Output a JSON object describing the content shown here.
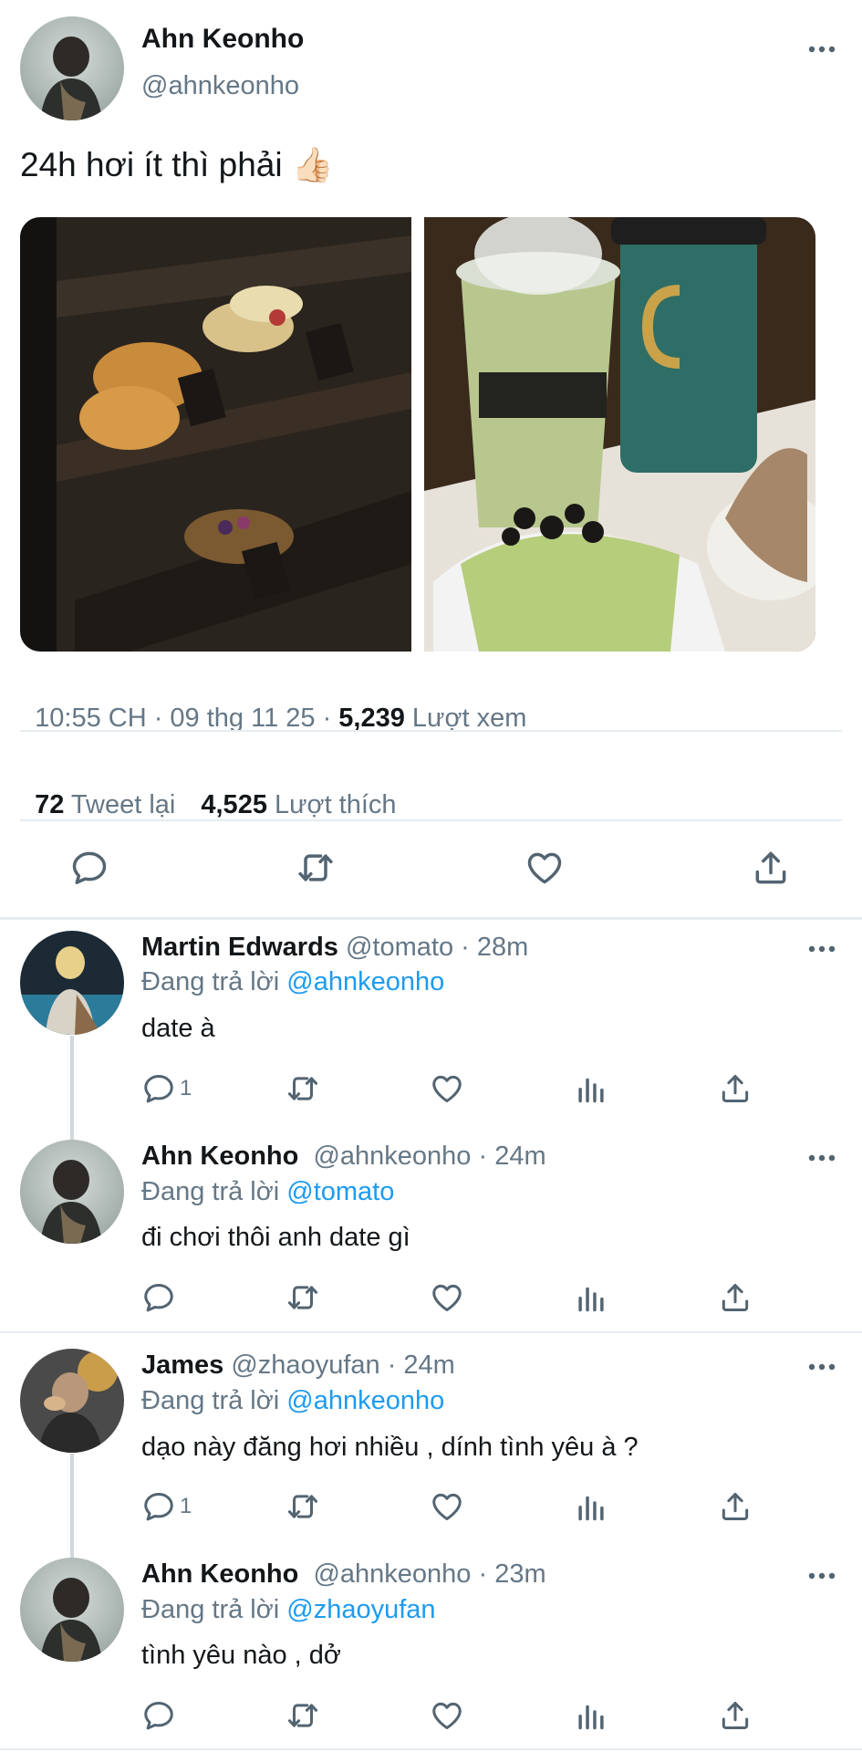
{
  "main_tweet": {
    "author_name": "Ahn Keonho",
    "handle": "@ahnkeonho",
    "text": "24h hơi ít thì phải 👍🏻",
    "time": "10:55 CH · 09 thg 11 25 · ",
    "views_count": "5,239",
    "views_label": " Lượt xem",
    "retweets_count": "72",
    "retweets_label": " Tweet lại",
    "likes_count": "4,525",
    "likes_label": " Lượt thích"
  },
  "replies": [
    {
      "name": "Martin Edwards",
      "meta": " @tomato · 28m",
      "replying_prefix": "Đang trả lời ",
      "replying_to": "@ahnkeonho",
      "text": "date à",
      "reply_count": "1"
    },
    {
      "name": "Ahn Keonho",
      "meta": "  @ahnkeonho · 24m",
      "replying_prefix": "Đang trả lời ",
      "replying_to": "@tomato",
      "text": "đi chơi thôi anh date gì",
      "reply_count": ""
    },
    {
      "name": "James",
      "meta": " @zhaoyufan · 24m",
      "replying_prefix": "Đang trả lời ",
      "replying_to": "@ahnkeonho",
      "text": "dạo này đăng hơi nhiều , dính tình yêu à ?",
      "reply_count": "1"
    },
    {
      "name": "Ahn Keonho",
      "meta": "  @ahnkeonho · 23m",
      "replying_prefix": "Đang trả lời ",
      "replying_to": "@zhaoyufan",
      "text": "tình yêu nào , dở",
      "reply_count": ""
    }
  ],
  "colors": {
    "link": "#1d9bf0",
    "secondary_text": "#657786",
    "icon": "#536471",
    "divider": "#e6ecf0"
  },
  "icons": [
    "more-icon",
    "reply-icon",
    "retweet-icon",
    "like-icon",
    "share-icon",
    "views-icon"
  ]
}
